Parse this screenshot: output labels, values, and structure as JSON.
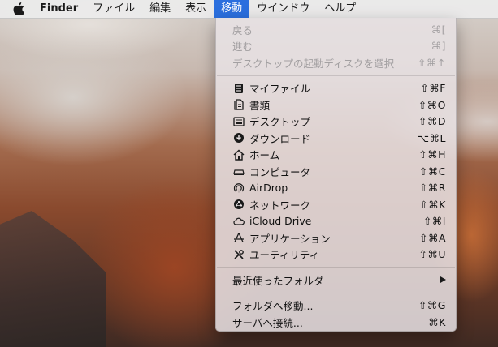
{
  "menubar": {
    "apple_icon": "apple-logo-icon",
    "items": [
      "Finder",
      "ファイル",
      "編集",
      "表示",
      "移動",
      "ウインドウ",
      "ヘルプ"
    ],
    "active_index": 4
  },
  "go_menu": {
    "history": [
      {
        "label": "戻る",
        "shortcut": "⌘[",
        "enabled": false
      },
      {
        "label": "進む",
        "shortcut": "⌘]",
        "enabled": false
      },
      {
        "label": "デスクトップの起動ディスクを選択",
        "shortcut": "⇧⌘↑",
        "enabled": false
      }
    ],
    "places": [
      {
        "label": "マイファイル",
        "shortcut": "⇧⌘F",
        "icon": "all-my-files-icon"
      },
      {
        "label": "書類",
        "shortcut": "⇧⌘O",
        "icon": "documents-icon"
      },
      {
        "label": "デスクトップ",
        "shortcut": "⇧⌘D",
        "icon": "desktop-icon"
      },
      {
        "label": "ダウンロード",
        "shortcut": "⌥⌘L",
        "icon": "downloads-icon"
      },
      {
        "label": "ホーム",
        "shortcut": "⇧⌘H",
        "icon": "home-icon"
      },
      {
        "label": "コンピュータ",
        "shortcut": "⇧⌘C",
        "icon": "computer-icon"
      },
      {
        "label": "AirDrop",
        "shortcut": "⇧⌘R",
        "icon": "airdrop-icon"
      },
      {
        "label": "ネットワーク",
        "shortcut": "⇧⌘K",
        "icon": "network-icon"
      },
      {
        "label": "iCloud Drive",
        "shortcut": "⇧⌘I",
        "icon": "icloud-icon"
      },
      {
        "label": "アプリケーション",
        "shortcut": "⇧⌘A",
        "icon": "applications-icon"
      },
      {
        "label": "ユーティリティ",
        "shortcut": "⇧⌘U",
        "icon": "utilities-icon"
      }
    ],
    "recent_folders": {
      "label": "最近使ったフォルダ",
      "icon": "submenu-arrow-icon"
    },
    "actions": [
      {
        "label": "フォルダへ移動...",
        "shortcut": "⇧⌘G"
      },
      {
        "label": "サーバへ接続...",
        "shortcut": "⌘K"
      }
    ]
  }
}
